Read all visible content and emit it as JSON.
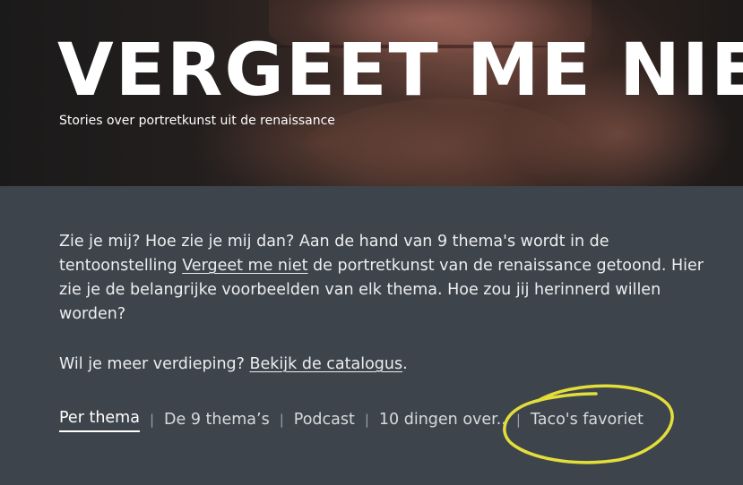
{
  "hero": {
    "title": "VERGEET ME NIET",
    "subtitle": "Stories over portretkunst uit de renaissance"
  },
  "intro": {
    "part1": "Zie je mij? Hoe zie je mij dan? Aan de hand van 9 thema's wordt in de tentoonstelling ",
    "link": "Vergeet me niet",
    "part2": " de portretkunst van de renaissance getoond. Hier zie je de belangrijke voorbeelden van elk thema. Hoe zou jij herinnerd willen worden?"
  },
  "more": {
    "text": "Wil je meer verdieping? ",
    "link": "Bekijk de catalogus",
    "end": "."
  },
  "nav": {
    "separator": "|",
    "items": [
      {
        "label": "Per thema",
        "active": true
      },
      {
        "label": "De 9 thema’s"
      },
      {
        "label": "Podcast"
      },
      {
        "label": "10 dingen over.."
      },
      {
        "label": "Taco's favoriet"
      }
    ]
  },
  "colors": {
    "background": "#3d444c",
    "text": "#eceef0",
    "highlight_circle": "#e4de3a"
  }
}
